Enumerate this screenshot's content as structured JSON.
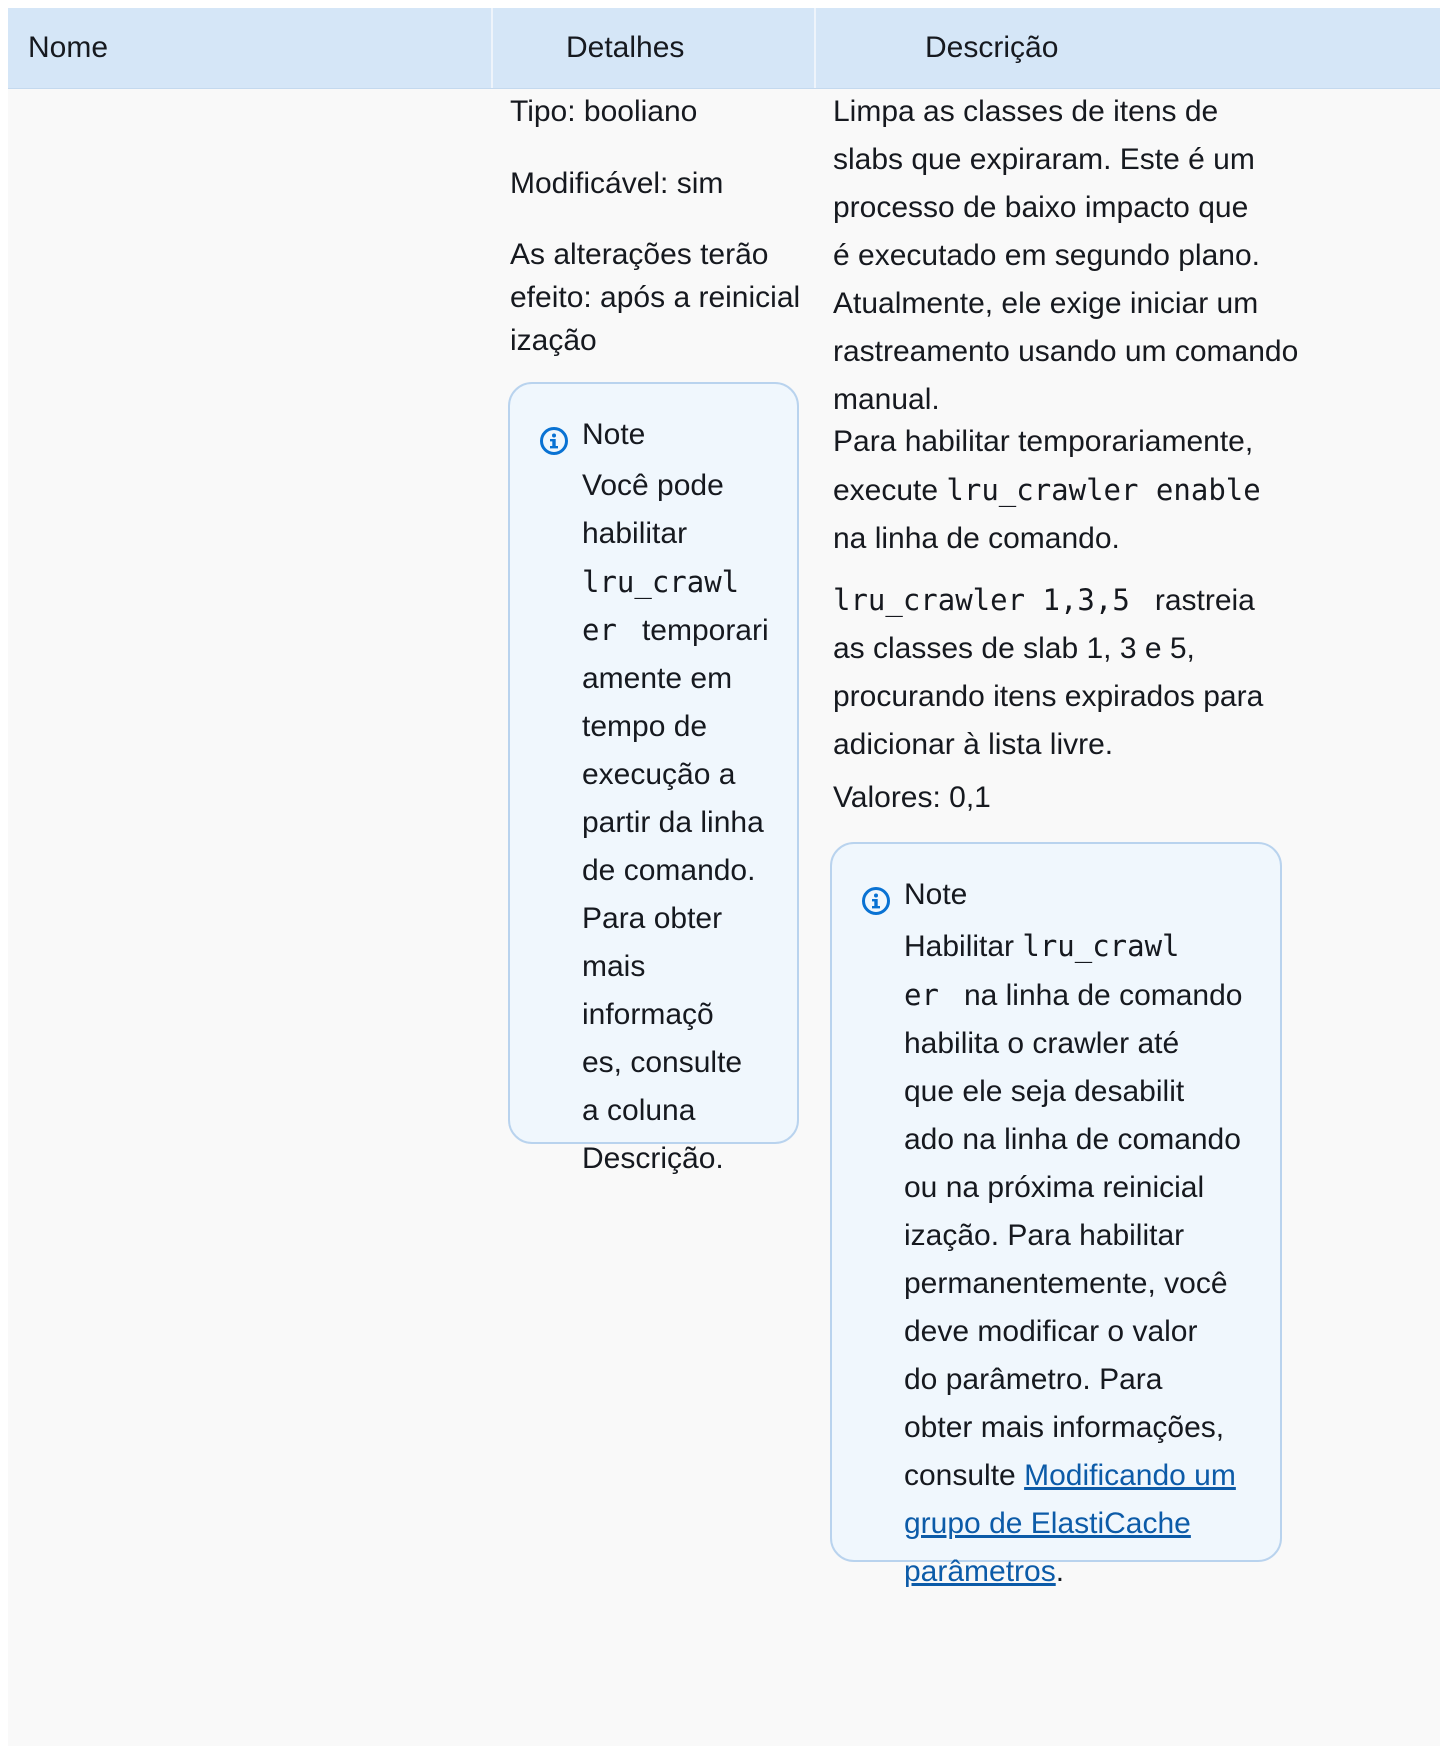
{
  "table": {
    "headers": {
      "name": "Nome",
      "details": "Detalhes",
      "description": "Descrição"
    },
    "row": {
      "details": {
        "type": "Tipo: booliano",
        "modifiable": "Modificável: sim",
        "changes_line1": "As alterações terão",
        "changes_line2": "efeito: após a reinicial",
        "changes_line3": "ização",
        "note": {
          "title": "Note",
          "icon": "info-icon",
          "lines": [
            "Você pode",
            "habilitar",
            "lru_crawl",
            "er",
            "temporari",
            "amente em",
            "tempo de",
            "execução a",
            "partir da linha",
            "de comando.",
            "Para obter",
            "mais",
            "informaçõ",
            "es, consulte",
            "a coluna",
            "Descrição."
          ]
        }
      },
      "description": {
        "para1_lines": [
          "Limpa as classes de itens de",
          "slabs que expiraram. Este é um",
          "processo de baixo impacto que",
          "é executado em segundo plano.",
          "Atualmente, ele exige iniciar um",
          "rastreamento usando um comando",
          "manual."
        ],
        "para2_line1": "Para habilitar temporariamente,",
        "para2_prefix": "execute ",
        "para2_code": "lru_crawler enable",
        "para2_line3": "na linha de comando.",
        "para3_code": "lru_crawler 1,3,5",
        "para3_text1": "rastreia",
        "para3_line2": "as classes de slab 1, 3 e 5,",
        "para3_line3": "procurando itens expirados para",
        "para3_line4": "adicionar à lista livre.",
        "values": "Valores: 0,1",
        "note": {
          "title": "Note",
          "icon": "info-icon",
          "l1_text": "Habilitar ",
          "l1_code": "lru_crawl",
          "l2_code": "er",
          "l2_text": "na linha de comando",
          "lines": [
            "habilita o crawler até",
            "que ele seja desabilit",
            "ado na linha de comando",
            "ou na próxima reinicial",
            "ização. Para habilitar",
            "permanentemente, você",
            "deve modificar o valor",
            "do parâmetro. Para",
            "obter mais informações,"
          ],
          "consult_prefix": "consulte ",
          "link_line1": "Modificando um",
          "link_line2": "grupo de ElastiCache",
          "link_line3": "parâmetros",
          "end_punct": "."
        }
      }
    }
  },
  "colors": {
    "header_bg": "#d5e6f7",
    "row_bg": "#f9f9f9",
    "note_bg": "#f0f7fd",
    "note_border": "#b9d3ee",
    "icon_color": "#0972d3",
    "link_color": "#0c5ba8"
  }
}
